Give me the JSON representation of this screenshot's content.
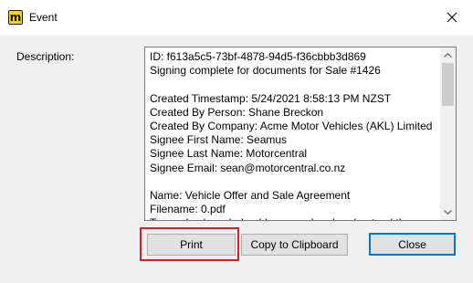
{
  "window": {
    "title": "Event",
    "app_icon_letter": "m",
    "app_icon_color": "#f7d21a"
  },
  "form": {
    "description_label": "Description:",
    "description_text": "ID: f613a5c5-73bf-4878-94d5-f36cbbb3d869\nSigning complete for documents for Sale #1426\n\nCreated Timestamp: 5/24/2021 8:58:13 PM NZST\nCreated By Person: Shane Breckon\nCreated By Company: Acme Motor Vehicles (AKL) Limited\nSignee First Name: Seamus\nSignee Last Name: Motorcentral\nSignee Email: sean@motorcentral.co.nz\n\nName: Vehicle Offer and Sale Agreement\nFilename: 0.pdf\nTerms: I acknowledge I have read and understand the"
  },
  "buttons": {
    "print": "Print",
    "copy": "Copy to Clipboard",
    "close": "Close"
  },
  "colors": {
    "highlight": "#e01b1b",
    "default_button_border": "#0078d7"
  },
  "icons": {
    "close": "close-icon",
    "scroll_up": "scroll-up-arrow-icon",
    "scroll_down": "scroll-down-arrow-icon"
  }
}
